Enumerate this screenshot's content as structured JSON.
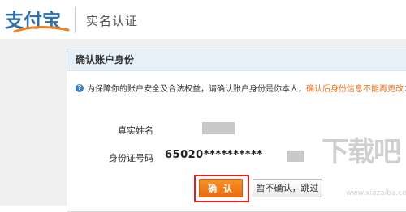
{
  "header": {
    "logo_text": "支付宝",
    "title": "实名认证"
  },
  "panel": {
    "title": "确认账户身份",
    "notice_text": "为保障你的账户安全及合法权益，请确认账户身份是你本人，",
    "notice_warning": "确认后身份信息不能再更改",
    "notice_end": "：",
    "name_label": "真实姓名",
    "id_label": "身份证号码",
    "id_value": "65020**********",
    "confirm_button": "确 认",
    "skip_button": "暂不确认，跳过"
  },
  "watermark": {
    "text": "下载吧",
    "url": "www.xiazaiba.com"
  },
  "colors": {
    "brand_blue": "#2f70ad",
    "confirm_orange": "#f08020",
    "warning_orange": "#e8731c",
    "highlight_red": "#e02020",
    "panel_head_bg": "#e6f0f8"
  },
  "icons": [
    "alipay-logo",
    "info-icon"
  ]
}
